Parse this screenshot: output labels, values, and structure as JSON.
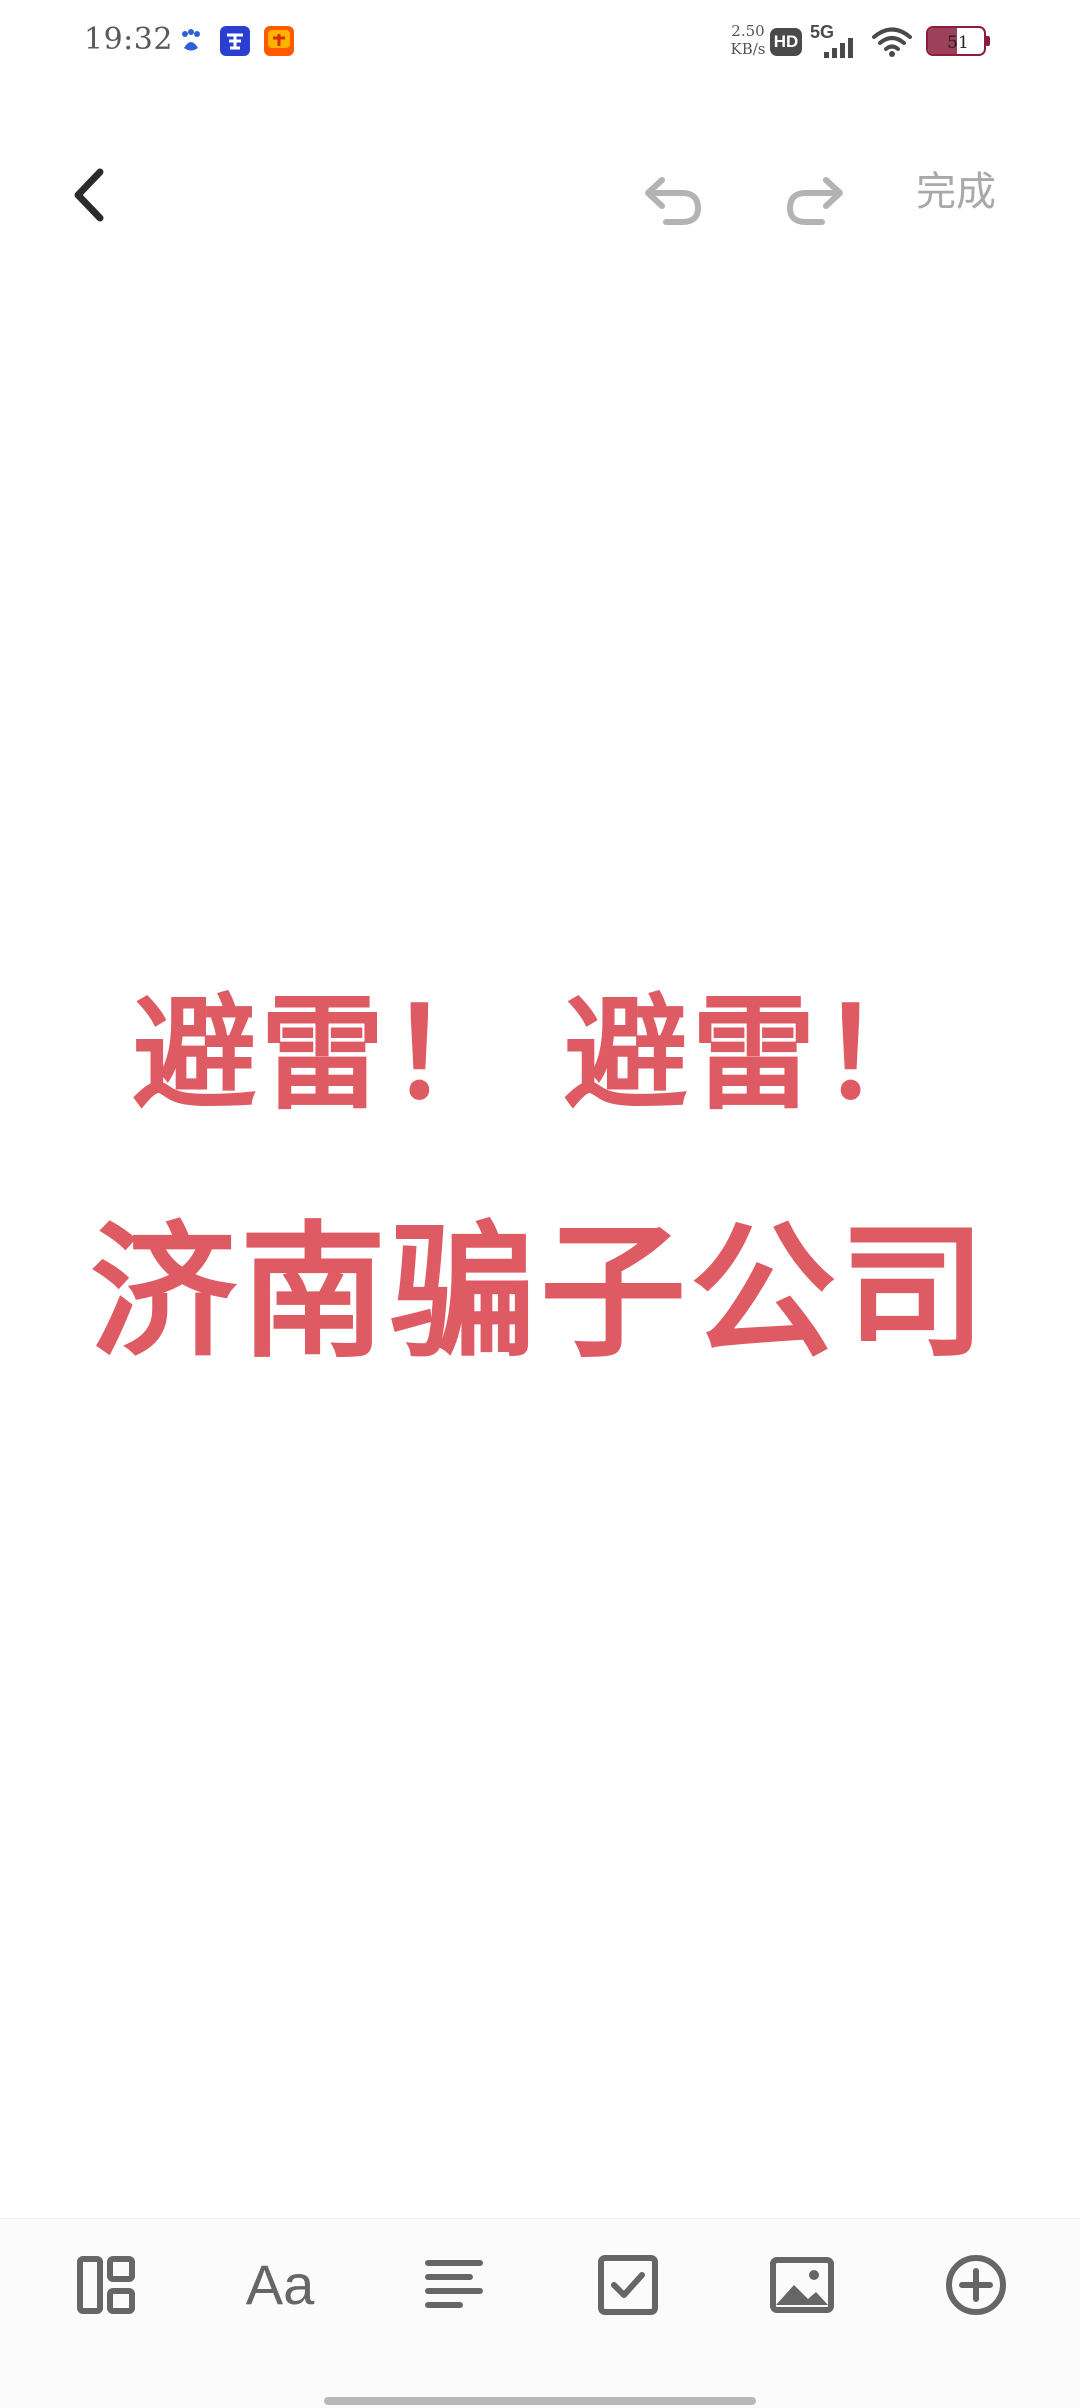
{
  "status_bar": {
    "time": "19:32",
    "net_speed_value": "2.50",
    "net_speed_unit": "KB/s",
    "hd_label": "HD",
    "network_label": "5G",
    "battery_level": 51,
    "battery_text": "51",
    "notification_icons": [
      "baidu-icon",
      "zhaopin-icon",
      "taobao-icon"
    ]
  },
  "toolbar": {
    "done_label": "完成"
  },
  "note": {
    "line1": "避雷！ 避雷！",
    "line2": "济南骗子公司"
  },
  "bottom_toolbar": {
    "text_style_label": "Aa",
    "tools": [
      "layout-icon",
      "text-style-icon",
      "align-icon",
      "checklist-icon",
      "image-icon",
      "add-icon"
    ]
  },
  "colors": {
    "accent": "#de5b63",
    "toolbar_icon": "#666666",
    "disabled": "#a9a9a9",
    "battery": "#8b1e3f"
  }
}
